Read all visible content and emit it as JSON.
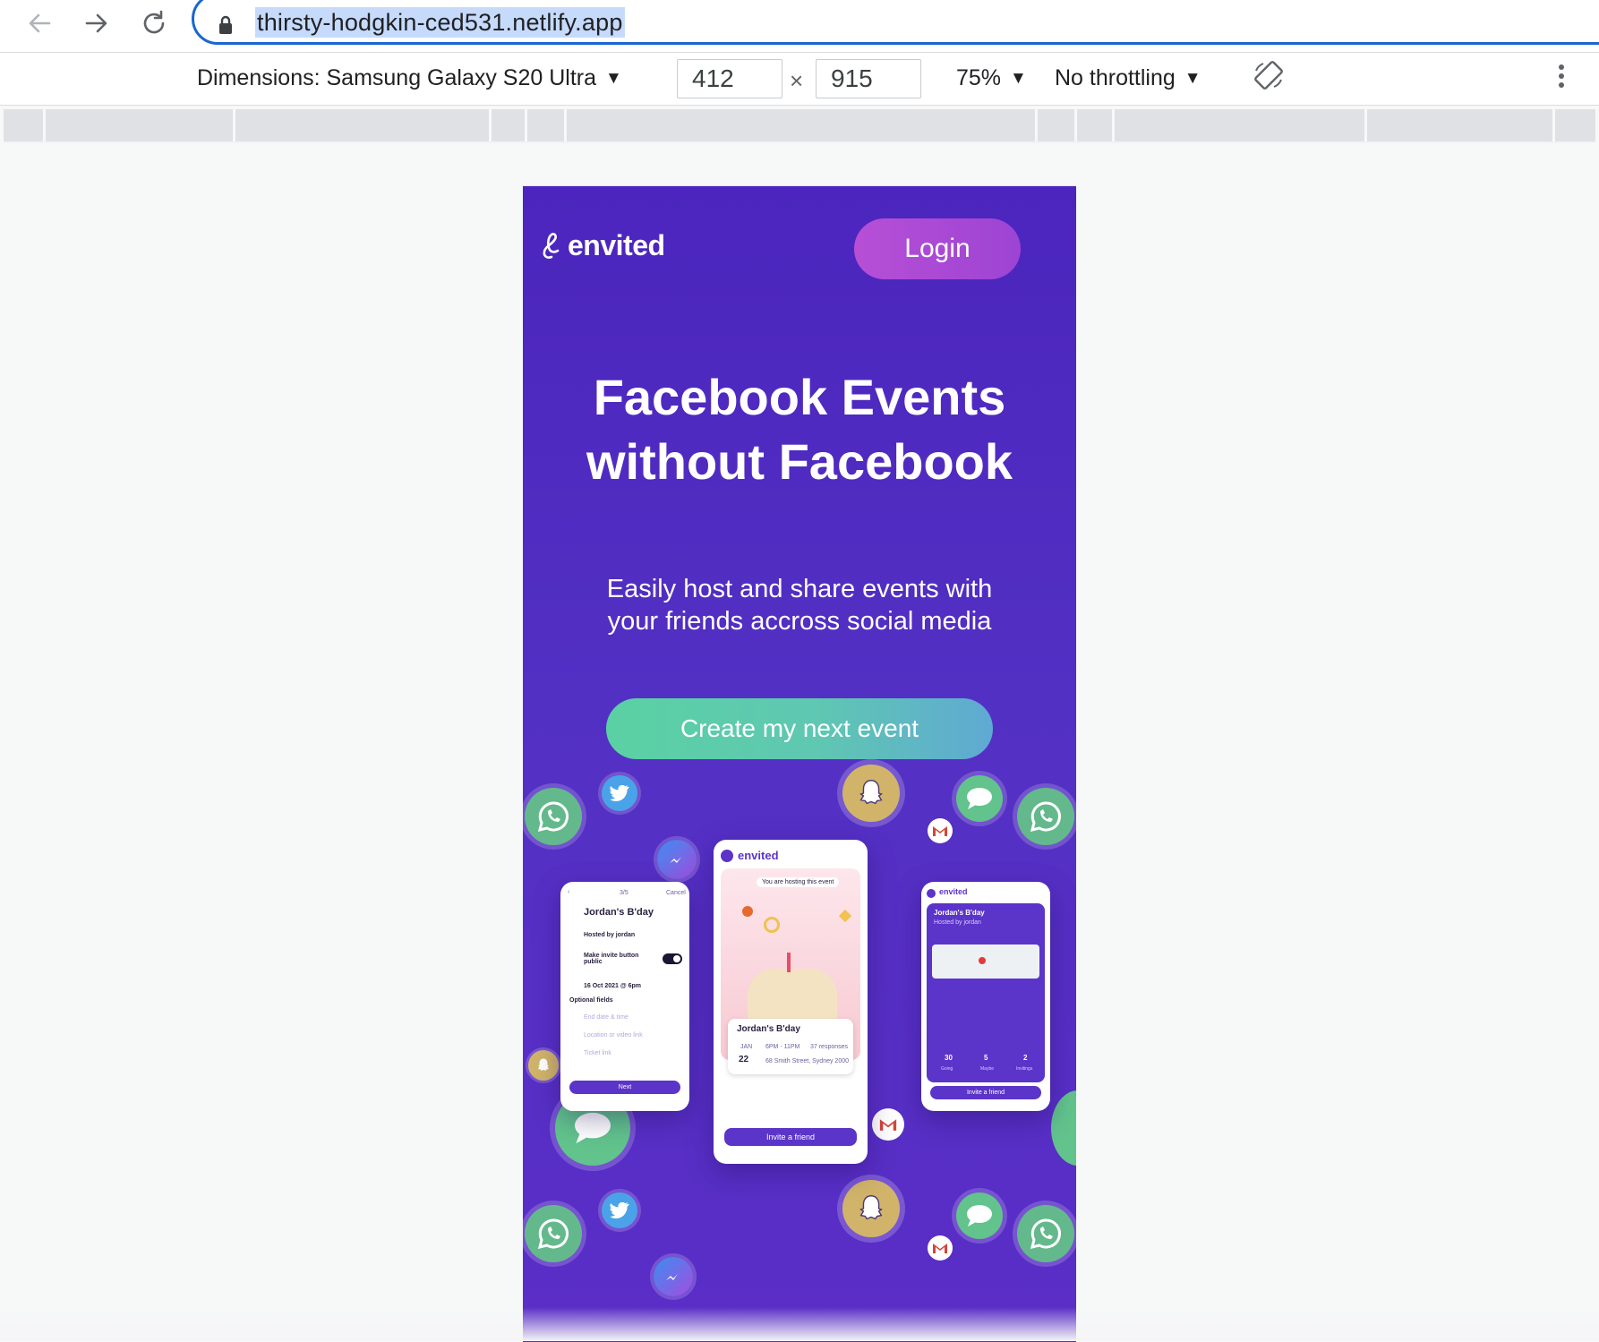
{
  "browser": {
    "url": "thirsty-hodgkin-ced531.netlify.app"
  },
  "devtools": {
    "dimensions_label": "Dimensions: Samsung Galaxy S20 Ultra",
    "width": "412",
    "times": "×",
    "height": "915",
    "zoom": "75%",
    "throttling": "No throttling"
  },
  "site": {
    "logo_text": "envited",
    "login_label": "Login",
    "headline_line1": "Facebook Events",
    "headline_line2": "without Facebook",
    "subtext": "Easily host and share events with your friends accross social media",
    "cta_label": "Create my next event",
    "colors": {
      "background": "#4b25bd",
      "login": "#b74fd6",
      "cta_start": "#5ad1a3",
      "cta_end": "#5fa9d3"
    }
  },
  "mockups": {
    "left": {
      "step": "3/5",
      "cancel": "Cancel",
      "event_title": "Jordan's B'day",
      "hosted_by": "Hosted by jordan",
      "invite_public": "Make invite button public",
      "date": "16 Oct 2021 @ 6pm",
      "optional_fields": "Optional fields",
      "end_date": "End date & time",
      "location": "Location or video link",
      "ticket": "Ticket link",
      "next": "Next"
    },
    "center": {
      "brand": "envited",
      "hosting_note": "You are hosting this event",
      "event_title": "Jordan's B'day",
      "month": "JAN",
      "day": "22",
      "time": "6PM - 11PM",
      "responses": "37 responses",
      "address": "68 Smith Street, Sydney 2000",
      "invite": "Invite a friend"
    },
    "right": {
      "brand": "envited",
      "event_title": "Jordan's B'day",
      "hosted": "Hosted by jordan",
      "going": "30",
      "maybe": "5",
      "invited": "2",
      "going_label": "Going",
      "maybe_label": "Maybe",
      "invited_label": "Invitings",
      "invite": "Invite a friend"
    }
  }
}
